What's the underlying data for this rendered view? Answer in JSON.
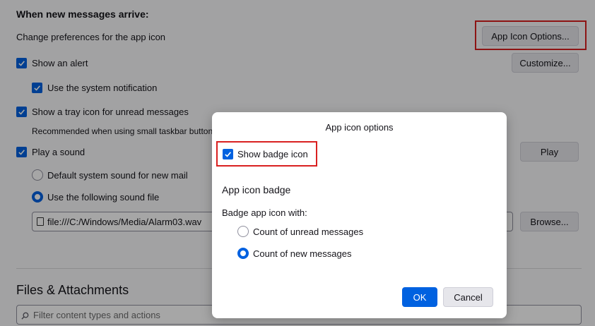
{
  "settings": {
    "section_heading": "When new messages arrive:",
    "app_icon_pref_label": "Change preferences for the app icon",
    "app_icon_options_button": "App Icon Options...",
    "show_alert": "Show an alert",
    "customize_button": "Customize...",
    "use_system_notification": "Use the system notification",
    "show_tray_icon": "Show a tray icon for unread messages",
    "tray_recommendation": "Recommended when using small taskbar buttons",
    "play_sound": "Play a sound",
    "play_button": "Play",
    "default_sound": "Default system sound for new mail",
    "use_following_sound": "Use the following sound file",
    "sound_file_path": "file:///C:/Windows/Media/Alarm03.wav",
    "browse_button": "Browse...",
    "files_heading": "Files & Attachments",
    "filter_placeholder": "Filter content types and actions"
  },
  "dialog": {
    "title": "App icon options",
    "show_badge_icon": "Show badge icon",
    "badge_heading": "App icon badge",
    "badge_with_label": "Badge app icon with:",
    "options": [
      {
        "label": "Count of unread messages",
        "selected": false
      },
      {
        "label": "Count of new messages",
        "selected": true
      }
    ],
    "ok_button": "OK",
    "cancel_button": "Cancel"
  },
  "colors": {
    "accent": "#0061e0",
    "highlight_box": "#d92020"
  }
}
